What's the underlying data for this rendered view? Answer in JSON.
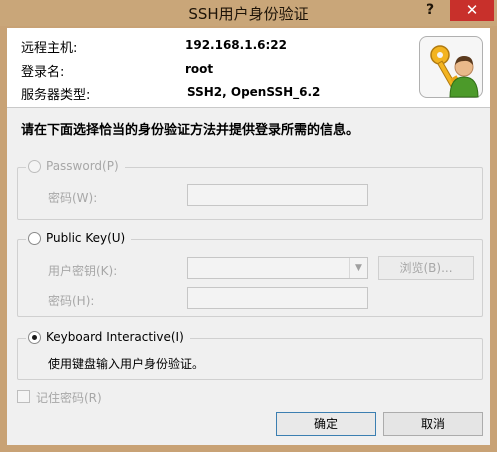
{
  "window": {
    "title": "SSH用户身份验证",
    "help_glyph": "?",
    "close_glyph": "✕"
  },
  "info": {
    "remote_host_label": "远程主机:",
    "remote_host_value": "192.168.1.6:22",
    "login_label": "登录名:",
    "login_value": "root",
    "server_type_label": "服务器类型:",
    "server_type_value": "SSH2, OpenSSH_6.2",
    "icon": "user-key-icon"
  },
  "instruction": "请在下面选择恰当的身份验证方法并提供登录所需的信息。",
  "methods": {
    "password": {
      "label": "Password(P)",
      "password_label": "密码(W):",
      "password_value": ""
    },
    "public_key": {
      "label": "Public Key(U)",
      "user_key_label": "用户密钥(K):",
      "user_key_value": "",
      "browse_label": "浏览(B)...",
      "password_label": "密码(H):",
      "password_value": ""
    },
    "keyboard_interactive": {
      "label": "Keyboard Interactive(I)",
      "description": "使用键盘输入用户身份验证。",
      "selected": true
    }
  },
  "remember_password": {
    "label": "记住密码(R)",
    "checked": false
  },
  "buttons": {
    "ok_label": "确定",
    "cancel_label": "取消"
  },
  "colors": {
    "titlebar": "#c9a679",
    "close_button": "#c8302b",
    "dialog_background": "#f0f0f0"
  }
}
